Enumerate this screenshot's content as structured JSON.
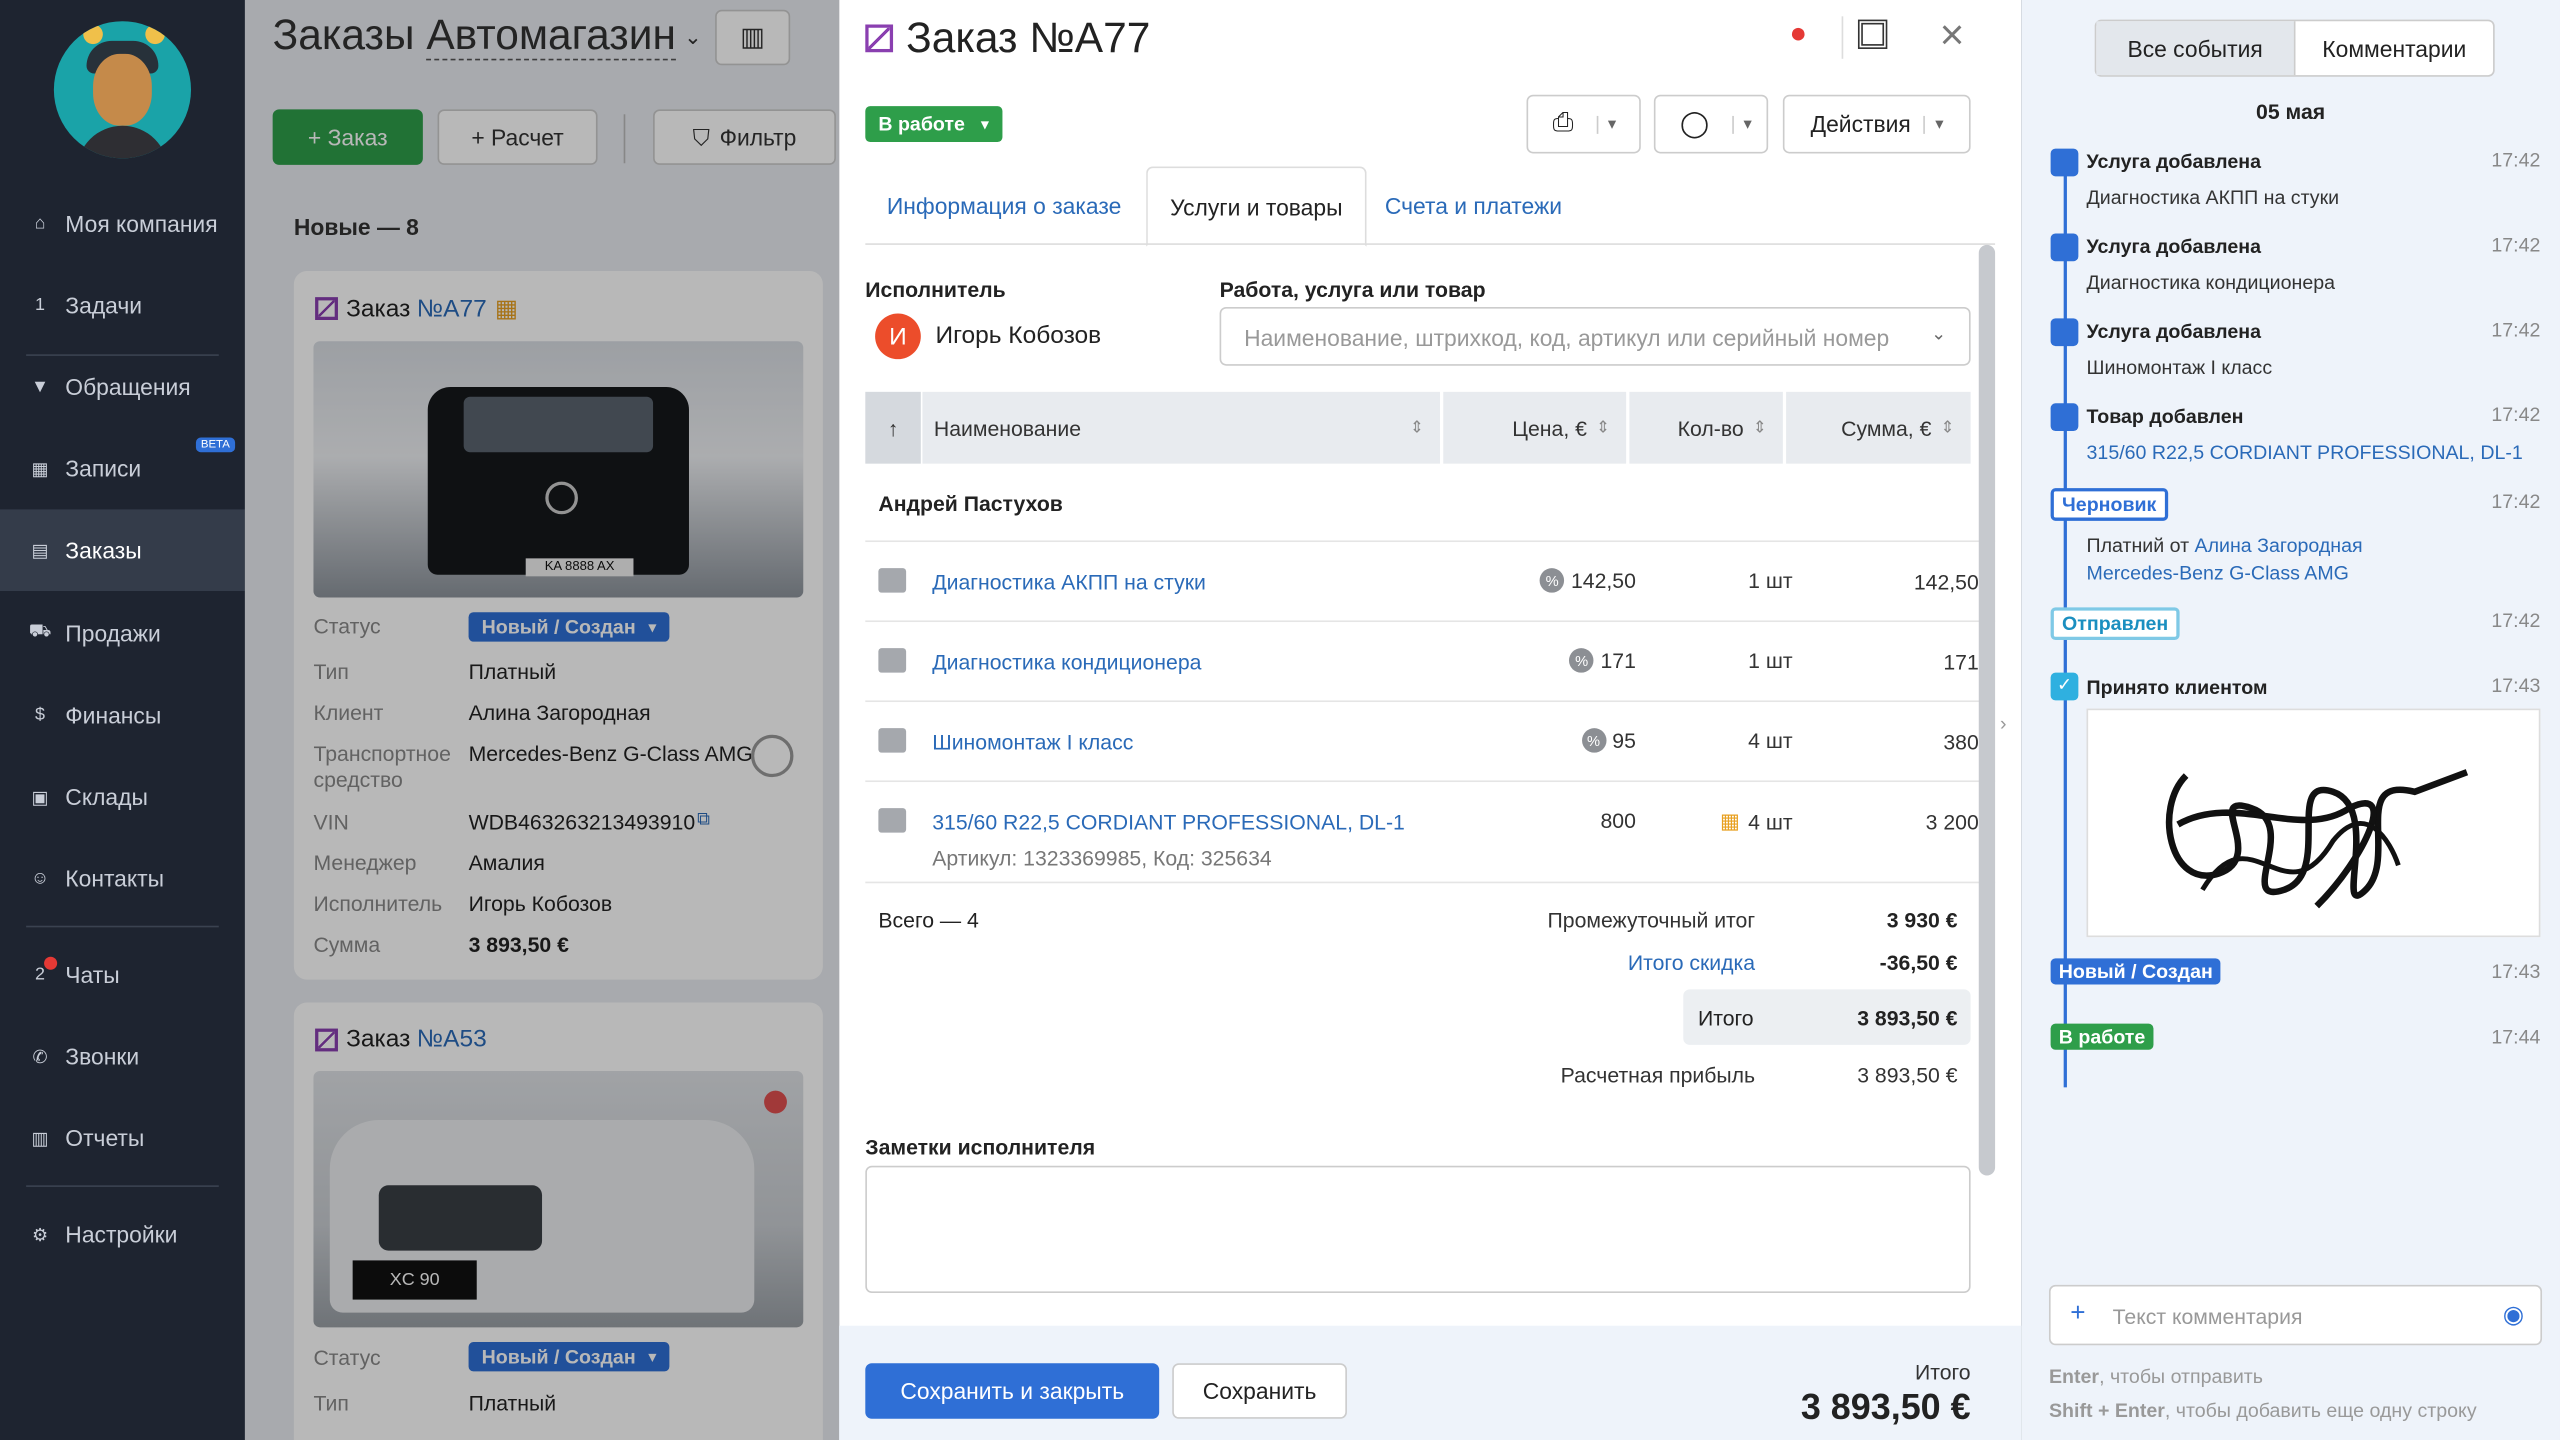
{
  "sidebar": {
    "items": [
      {
        "label": "Моя компания",
        "icon": "home-icon",
        "glyph": "⌂"
      },
      {
        "label": "Задачи",
        "icon": "tasks-icon",
        "glyph": "1"
      },
      {
        "label": "Обращения",
        "icon": "funnel-icon",
        "glyph": "▼"
      },
      {
        "label": "Записи",
        "icon": "calendar-icon",
        "glyph": "▦",
        "badge": "BETA"
      },
      {
        "label": "Заказы",
        "icon": "orders-icon",
        "glyph": "▤"
      },
      {
        "label": "Продажи",
        "icon": "cart-icon",
        "glyph": "⛟"
      },
      {
        "label": "Финансы",
        "icon": "dollar-icon",
        "glyph": "$"
      },
      {
        "label": "Склады",
        "icon": "boxes-icon",
        "glyph": "▣"
      },
      {
        "label": "Контакты",
        "icon": "people-icon",
        "glyph": "☺"
      },
      {
        "label": "Чаты",
        "icon": "chat-icon",
        "glyph": "2"
      },
      {
        "label": "Звонки",
        "icon": "phone-icon",
        "glyph": "✆"
      },
      {
        "label": "Отчеты",
        "icon": "report-icon",
        "glyph": "▥"
      },
      {
        "label": "Настройки",
        "icon": "gear-icon",
        "glyph": "⚙"
      }
    ]
  },
  "board": {
    "title_prefix": "Заказы",
    "title_store": "Автомагазин",
    "order_button": "+ Заказ",
    "calc_button": "+ Расчет",
    "filter_button": "Фильтр",
    "column_title": "Новые — 8",
    "card1": {
      "title": "Заказ",
      "num": "№A77",
      "status": "Новый / Создан",
      "fields": [
        {
          "k": "Статус",
          "v": ""
        },
        {
          "k": "Тип",
          "v": "Платный"
        },
        {
          "k": "Клиент",
          "v": "Алина Загородная"
        },
        {
          "k": "Транспортное средство",
          "v": "Mercedes-Benz G-Class AMG"
        },
        {
          "k": "VIN",
          "v": "WDB463263213493910"
        },
        {
          "k": "Менеджер",
          "v": "Амалия"
        },
        {
          "k": "Исполнитель",
          "v": "Игорь Кобозов"
        },
        {
          "k": "Сумма",
          "v": "3 893,50 €"
        }
      ],
      "plate": "KA 8888 AX"
    },
    "card2": {
      "title": "Заказ",
      "num": "№A53",
      "status": "Новый / Создан",
      "fields": [
        {
          "k": "Статус",
          "v": ""
        },
        {
          "k": "Тип",
          "v": "Платный"
        }
      ],
      "plate": "XC 90"
    }
  },
  "modal": {
    "title": "Заказ №A77",
    "status": "В работе",
    "actions_label": "Действия",
    "tabs": [
      "Информация о заказе",
      "Услуги и товары",
      "Счета и платежи"
    ],
    "executor_label": "Исполнитель",
    "executor_initial": "И",
    "executor_name": "Игорь Кобозов",
    "product_label": "Работа, услуга или товар",
    "product_placeholder": "Наименование, штрихкод, код, артикул или серийный номер",
    "columns": {
      "name": "Наименование",
      "price": "Цена, €",
      "qty": "Кол-во",
      "sum": "Сумма, €"
    },
    "group_name": "Андрей Пастухов",
    "rows": [
      {
        "name": "Диагностика АКПП на стуки",
        "price": "142,50",
        "qty": "1 шт",
        "sum": "142,50",
        "disc": true
      },
      {
        "name": "Диагностика кондиционера",
        "price": "171",
        "qty": "1 шт",
        "sum": "171",
        "disc": true
      },
      {
        "name": "Шиномонтаж I класс",
        "price": "95",
        "qty": "4 шт",
        "sum": "380",
        "disc": true
      },
      {
        "name": "315/60 R22,5 CORDIANT PROFESSIONAL, DL-1",
        "sub": "Артикул: 1323369985, Код: 325634",
        "price": "800",
        "qty": "4 шт",
        "sum": "3 200",
        "disc": false
      }
    ],
    "total_count": "Всего — 4",
    "subtotal_label": "Промежуточный итог",
    "subtotal": "3 930 €",
    "discount_label": "Итого скидка",
    "discount": "-36,50 €",
    "total_label": "Итого",
    "total": "3 893,50 €",
    "profit_label": "Расчетная прибыль",
    "profit": "3 893,50 €",
    "notes_label": "Заметки исполнителя",
    "save_close": "Сохранить и закрыть",
    "save": "Сохранить",
    "footer_total_label": "Итого",
    "footer_total": "3 893,50 €"
  },
  "history": {
    "tab_all": "Все события",
    "tab_comments": "Комментарии",
    "date": "05 мая",
    "events": [
      {
        "title": "Услуга добавлена",
        "text": "Диагностика АКПП на стуки",
        "time": "17:42"
      },
      {
        "title": "Услуга добавлена",
        "text": "Диагностика кондиционера",
        "time": "17:42"
      },
      {
        "title": "Услуга добавлена",
        "text": "Шиномонтаж I класс",
        "time": "17:42"
      },
      {
        "title": "Товар добавлен",
        "text": "315/60 R22,5 CORDIANT PROFESSIONAL, DL-1",
        "time": "17:42"
      }
    ],
    "draft": {
      "chip": "Черновик",
      "time": "17:42",
      "line1_pre": "Платний от",
      "line1_link": "Алина Загородная",
      "line2": "Mercedes-Benz G-Class AMG"
    },
    "sent": {
      "chip": "Отправлен",
      "time": "17:42"
    },
    "accepted": {
      "title": "Принято клиентом",
      "time": "17:43"
    },
    "new": {
      "chip": "Новый / Создан",
      "time": "17:43"
    },
    "work": {
      "chip": "В работе",
      "time": "17:44"
    },
    "comment_placeholder": "Текст комментария",
    "hint1_key": "Enter",
    "hint1_rest": ", чтобы отправить",
    "hint2_key": "Shift + Enter",
    "hint2_rest": ", чтобы добавить еще одну строку"
  }
}
